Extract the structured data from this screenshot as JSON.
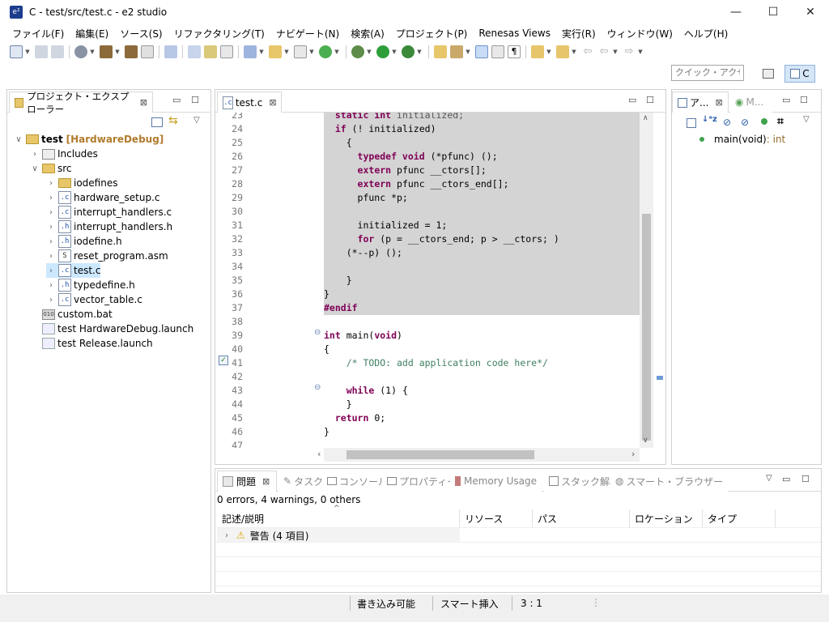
{
  "window": {
    "title": "C - test/src/test.c - e2 studio",
    "minimize": "—",
    "maximize": "☐",
    "close": "✕"
  },
  "menu": [
    "ファイル(F)",
    "編集(E)",
    "ソース(S)",
    "リファクタリング(T)",
    "ナビゲート(N)",
    "検索(A)",
    "プロジェクト(P)",
    "Renesas Views",
    "実行(R)",
    "ウィンドウ(W)",
    "ヘルプ(H)"
  ],
  "quick_access": {
    "placeholder": "クイック・アクセス"
  },
  "perspective": {
    "c_label": "C"
  },
  "explorer": {
    "tab_label": "プロジェクト・エクスプローラー",
    "project": {
      "name": "test",
      "config": "[HardwareDebug]"
    },
    "items": [
      {
        "label": "Includes",
        "icon": "includes-icon"
      },
      {
        "label": "src",
        "icon": "folder-icon"
      },
      {
        "label": "iodefines",
        "icon": "folder-icon"
      },
      {
        "label": "hardware_setup.c",
        "icon": "c-file-icon"
      },
      {
        "label": "interrupt_handlers.c",
        "icon": "c-file-icon"
      },
      {
        "label": "interrupt_handlers.h",
        "icon": "h-file-icon"
      },
      {
        "label": "iodefine.h",
        "icon": "h-file-icon"
      },
      {
        "label": "reset_program.asm",
        "icon": "asm-file-icon"
      },
      {
        "label": "test.c",
        "icon": "c-file-icon"
      },
      {
        "label": "typedefine.h",
        "icon": "h-file-icon"
      },
      {
        "label": "vector_table.c",
        "icon": "c-file-icon"
      },
      {
        "label": "custom.bat",
        "icon": "bat-file-icon"
      },
      {
        "label": "test HardwareDebug.launch",
        "icon": "launch-file-icon"
      },
      {
        "label": "test Release.launch",
        "icon": "launch-file-icon"
      }
    ]
  },
  "editor": {
    "tab_label": "test.c",
    "lines": [
      {
        "n": "23",
        "text": "  static int initialized;"
      },
      {
        "n": "24",
        "text": "  if (! initialized)"
      },
      {
        "n": "25",
        "text": "    {"
      },
      {
        "n": "26",
        "text": "      typedef void (*pfunc) ();"
      },
      {
        "n": "27",
        "text": "      extern pfunc __ctors[];"
      },
      {
        "n": "28",
        "text": "      extern pfunc __ctors_end[];"
      },
      {
        "n": "29",
        "text": "      pfunc *p;"
      },
      {
        "n": "30",
        "text": ""
      },
      {
        "n": "31",
        "text": "      initialized = 1;"
      },
      {
        "n": "32",
        "text": "      for (p = __ctors_end; p > __ctors; )"
      },
      {
        "n": "33",
        "text": "    (*--p) ();"
      },
      {
        "n": "34",
        "text": ""
      },
      {
        "n": "35",
        "text": "    }"
      },
      {
        "n": "36",
        "text": "}"
      },
      {
        "n": "37",
        "text": "#endif"
      },
      {
        "n": "38",
        "text": ""
      },
      {
        "n": "39",
        "text": "int main(void)"
      },
      {
        "n": "40",
        "text": "{"
      },
      {
        "n": "41",
        "text": "    /* TODO: add application code here*/"
      },
      {
        "n": "42",
        "text": ""
      },
      {
        "n": "43",
        "text": "    while (1) {"
      },
      {
        "n": "44",
        "text": "    }"
      },
      {
        "n": "45",
        "text": "  return 0;"
      },
      {
        "n": "46",
        "text": "}"
      },
      {
        "n": "47",
        "text": ""
      }
    ]
  },
  "outline": {
    "tab1": "ア...",
    "tab2": "M...",
    "item": {
      "name": "main(void)",
      "type": " : int"
    }
  },
  "problems": {
    "tabs": [
      "問題",
      "タスク",
      "コンソール",
      "プロパティー",
      "Memory Usage",
      "スタック解析",
      "スマート・ブラウザー"
    ],
    "summary": "0 errors, 4 warnings, 0 others",
    "columns": [
      "記述/説明",
      "リソース",
      "パス",
      "ロケーション",
      "タイプ"
    ],
    "rows": [
      {
        "label": "警告 (4 項目)"
      }
    ]
  },
  "status": {
    "writable": "書き込み可能",
    "insert_mode": "スマート挿入",
    "position": "3 : 1"
  }
}
